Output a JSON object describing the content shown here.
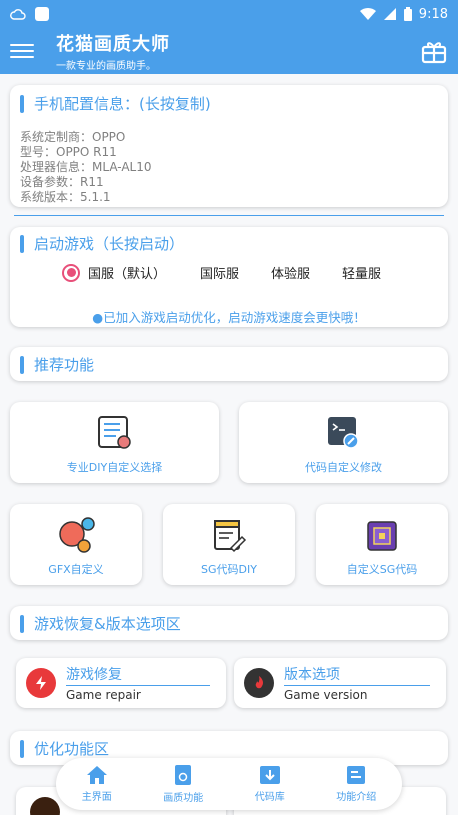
{
  "statusbar": {
    "time": "9:18",
    "icons": [
      "cloud-icon",
      "app-icon",
      "wifi-icon",
      "signal-icon",
      "battery-icon"
    ]
  },
  "appbar": {
    "title": "花猫画质大师",
    "subtitle": "一款专业的画质助手。",
    "icons": [
      "menu-icon",
      "gift-icon"
    ]
  },
  "device_info": {
    "title": "手机配置信息：(长按复制)",
    "lines": [
      "系统定制商：OPPO",
      "型号：OPPO R11",
      "处理器信息：MLA-AL10",
      "设备参数：R11",
      "系统版本：5.1.1"
    ]
  },
  "launch": {
    "title": "启动游戏（长按启动）",
    "options": [
      "国服（默认）",
      "国际服",
      "体验服",
      "轻量服"
    ],
    "selected": "国服（默认）",
    "note": "●已加入游戏启动优化，启动游戏速度会更快哦！"
  },
  "recommend": {
    "title": "推荐功能",
    "tiles_large": [
      "专业DIY自定义选择",
      "代码自定义修改"
    ],
    "tiles_small": [
      "GFX自定义",
      "SG代码DIY",
      "自定义SG代码"
    ]
  },
  "restore": {
    "title": "游戏恢复&版本选项区",
    "items": [
      {
        "cn": "游戏修复",
        "en": "Game repair"
      },
      {
        "cn": "版本选项",
        "en": "Game version"
      }
    ]
  },
  "optimize": {
    "title": "优化功能区"
  },
  "bottom_nav": [
    "主界面",
    "画质功能",
    "代码库",
    "功能介绍"
  ],
  "colors": {
    "primary": "#4a9fea",
    "radio": "#e8507a",
    "repair_red": "#e8393b",
    "version_dark": "#333333"
  }
}
